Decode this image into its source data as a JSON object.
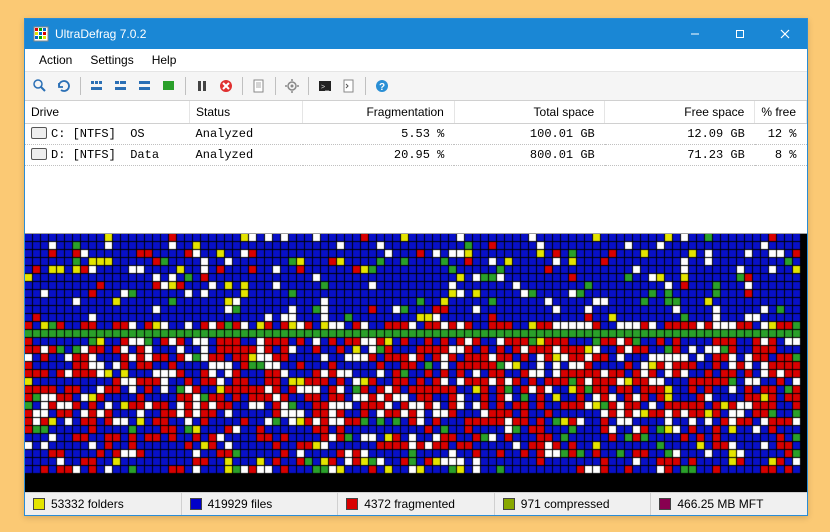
{
  "window": {
    "title": "UltraDefrag 7.0.2"
  },
  "menus": {
    "action": "Action",
    "settings": "Settings",
    "help": "Help"
  },
  "columns": {
    "drive": "Drive",
    "status": "Status",
    "fragmentation": "Fragmentation",
    "total": "Total space",
    "free": "Free space",
    "pctfree": "% free"
  },
  "drives": [
    {
      "name": "C: [NTFS]  OS",
      "status": "Analyzed",
      "frag": "5.53 %",
      "total": "100.01 GB",
      "free": "12.09 GB",
      "pctfree": "12 %"
    },
    {
      "name": "D: [NTFS]  Data",
      "status": "Analyzed",
      "frag": "20.95 %",
      "total": "800.01 GB",
      "free": "71.23 GB",
      "pctfree": "8 %"
    }
  ],
  "status": {
    "folders": {
      "label": "53332 folders",
      "color": "#e4e400"
    },
    "files": {
      "label": "419929 files",
      "color": "#0000c8"
    },
    "fragmented": {
      "label": "4372 fragmented",
      "color": "#d80000"
    },
    "compressed": {
      "label": "971 compressed",
      "color": "#88a800"
    },
    "mft": {
      "label": "466.25 MB MFT",
      "color": "#880050"
    }
  },
  "colors": {
    "allocated": "#0810c8",
    "free": "#ffffff",
    "fragmented": "#d80000",
    "mft": "#2aa02a",
    "compressed": "#88a800",
    "dir": "#e4e400",
    "grid": "#000000"
  }
}
